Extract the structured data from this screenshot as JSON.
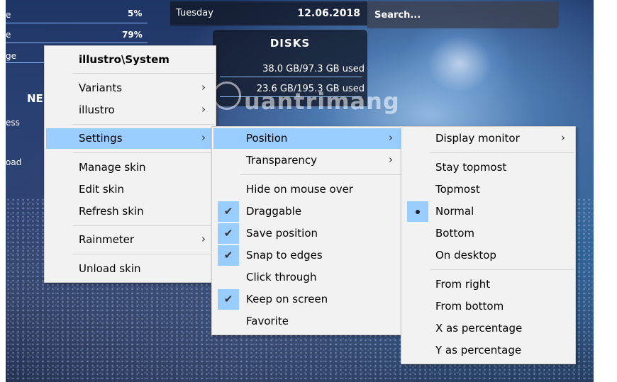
{
  "desktop": {
    "left_labels": [
      "e",
      "e",
      "ge",
      "NE",
      "ess",
      "oad"
    ],
    "left_percents": [
      "5%",
      "79%"
    ],
    "date_widget": {
      "day": "Tuesday",
      "date": "12.06.2018"
    },
    "search_widget": {
      "placeholder": "Search..."
    },
    "disks_widget": {
      "title": "DISKS",
      "disk1": "38.0 GB/97.3 GB used",
      "disk2": "23.6 GB/195.3 GB used"
    },
    "watermark": "uantrimang"
  },
  "menu_main": {
    "header": "illustro\\System",
    "items": [
      {
        "label": "Variants",
        "submenu": true
      },
      {
        "label": "illustro",
        "submenu": true
      },
      {
        "label": "Settings",
        "submenu": true,
        "highlighted": true
      },
      {
        "label": "Manage skin"
      },
      {
        "label": "Edit skin"
      },
      {
        "label": "Refresh skin"
      },
      {
        "label": "Rainmeter",
        "submenu": true
      },
      {
        "label": "Unload skin"
      }
    ]
  },
  "menu_settings": {
    "items": [
      {
        "label": "Position",
        "submenu": true,
        "highlighted": true
      },
      {
        "label": "Transparency",
        "submenu": true
      },
      {
        "label": "Hide on mouse over",
        "checked": false
      },
      {
        "label": "Draggable",
        "checked": true
      },
      {
        "label": "Save position",
        "checked": true
      },
      {
        "label": "Snap to edges",
        "checked": true
      },
      {
        "label": "Click through",
        "checked": false
      },
      {
        "label": "Keep on screen",
        "checked": true
      },
      {
        "label": "Favorite",
        "checked": false
      }
    ]
  },
  "menu_position": {
    "items": [
      {
        "label": "Display monitor",
        "submenu": true
      },
      {
        "label": "Stay topmost"
      },
      {
        "label": "Topmost"
      },
      {
        "label": "Normal",
        "selected": true
      },
      {
        "label": "Bottom"
      },
      {
        "label": "On desktop"
      },
      {
        "label": "From right"
      },
      {
        "label": "From bottom"
      },
      {
        "label": "X as percentage"
      },
      {
        "label": "Y as percentage"
      }
    ]
  },
  "icons": {
    "submenu_arrow": "chevron-right-icon",
    "check": "check-icon",
    "radio": "bullet-icon"
  },
  "colors": {
    "highlight": "#99ccff",
    "menu_bg": "#f2f2f2",
    "menu_border": "#cccccc"
  }
}
